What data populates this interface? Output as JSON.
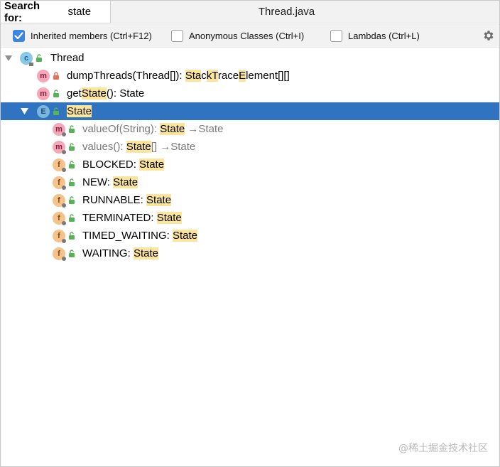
{
  "search": {
    "label": "Search for:",
    "value": "state"
  },
  "file_title": "Thread.java",
  "options": {
    "inherited": {
      "label": "Inherited members (Ctrl+F12)",
      "checked": true
    },
    "anonymous": {
      "label": "Anonymous Classes (Ctrl+I)",
      "checked": false
    },
    "lambdas": {
      "label": "Lambdas (Ctrl+L)",
      "checked": false
    }
  },
  "tree": {
    "root": {
      "label": "Thread",
      "icon": "class-icon"
    },
    "items": [
      {
        "icon": "m",
        "visibility": "private-lock",
        "text": "dumpThreads(Thread[]): ",
        "match_parts": [
          "Sta",
          "c",
          "k",
          "T",
          "race",
          "E",
          "lement[][]"
        ]
      },
      {
        "icon": "m",
        "visibility": "public",
        "pre": "get",
        "hl": "State",
        "post": "(): State"
      },
      {
        "icon": "e",
        "visibility": "public",
        "text": "State",
        "selected": true
      },
      {
        "icon": "m",
        "visibility": "public",
        "pre": "valueOf(String): ",
        "hl": "State",
        "post": " →State",
        "gray": true
      },
      {
        "icon": "m",
        "visibility": "public",
        "pre": "values(): ",
        "hl": "State",
        "post": "[] →State",
        "gray": true
      },
      {
        "icon": "f",
        "visibility": "public",
        "pre": "BLOCKED: ",
        "hl": "State"
      },
      {
        "icon": "f",
        "visibility": "public",
        "pre": "NEW: ",
        "hl": "State"
      },
      {
        "icon": "f",
        "visibility": "public",
        "pre": "RUNNABLE: ",
        "hl": "State"
      },
      {
        "icon": "f",
        "visibility": "public",
        "pre": "TERMINATED: ",
        "hl": "State"
      },
      {
        "icon": "f",
        "visibility": "public",
        "pre": "TIMED_WAITING: ",
        "hl": "State"
      },
      {
        "icon": "f",
        "visibility": "public",
        "pre": "WAITING: ",
        "hl": "State"
      }
    ]
  },
  "dump_label": {
    "a": "dumpThreads(Thread[]): ",
    "h1": "Sta",
    "b": "c",
    "h2": "k",
    "c": "",
    "h3": "T",
    "d": "race",
    "h4": "E",
    "e": "lement[][]"
  },
  "watermark": "@稀土掘金技术社区",
  "colors": {
    "selection": "#2f73c1",
    "highlight": "#fbe49c",
    "checkbox": "#3d85e0"
  }
}
